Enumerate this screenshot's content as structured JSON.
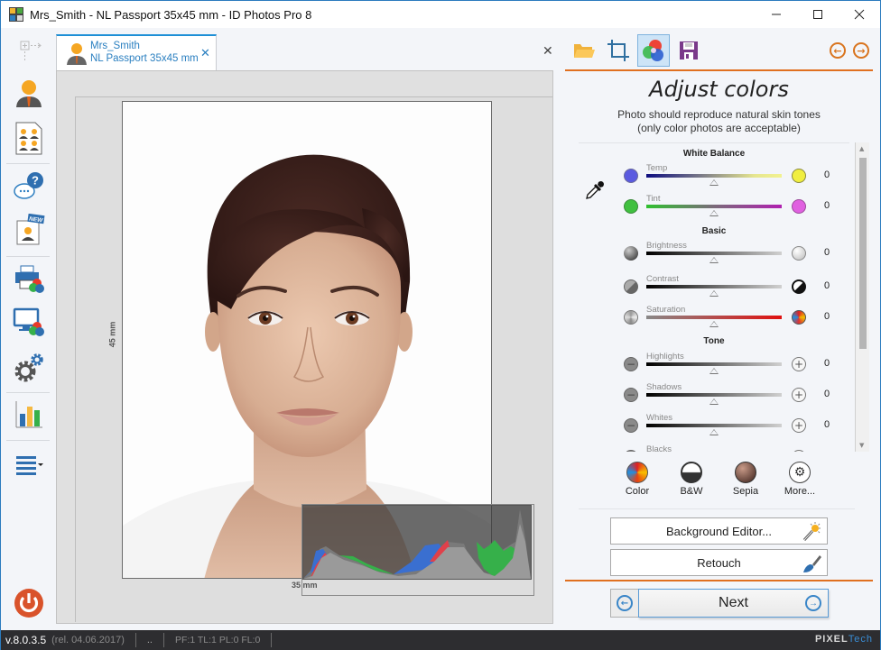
{
  "window": {
    "title": "Mrs_Smith - NL Passport 35x45 mm - ID Photos Pro 8",
    "controls": {
      "minimize": "—",
      "maximize": "☐",
      "close": "✕"
    }
  },
  "sidebar": {
    "items": [
      {
        "name": "new-project",
        "icon": "plus-arrow-icon"
      },
      {
        "name": "single-person",
        "icon": "person-icon"
      },
      {
        "name": "multi-photo-sheet",
        "icon": "multi-person-sheet-icon"
      },
      {
        "name": "help",
        "icon": "help-chat-icon"
      },
      {
        "name": "new-template",
        "icon": "new-badge-person-icon",
        "badge": "NEW"
      },
      {
        "name": "print-color",
        "icon": "printer-color-icon"
      },
      {
        "name": "monitor-color",
        "icon": "monitor-color-icon"
      },
      {
        "name": "settings",
        "icon": "gears-icon"
      },
      {
        "name": "statistics",
        "icon": "bar-chart-icon"
      },
      {
        "name": "menu",
        "icon": "hamburger-dropdown-icon"
      },
      {
        "name": "power",
        "icon": "power-icon"
      }
    ]
  },
  "doc_tab": {
    "name": "Mrs_Smith",
    "format": "NL Passport 35x45 mm",
    "close": "✕"
  },
  "canvas": {
    "close": "✕",
    "height_label": "45 mm",
    "width_label": "35 mm"
  },
  "right_panel": {
    "toolbar": [
      {
        "name": "open",
        "icon": "folder-icon"
      },
      {
        "name": "crop",
        "icon": "crop-icon"
      },
      {
        "name": "adjust-colors",
        "icon": "color-wheel-icon",
        "active": true
      },
      {
        "name": "save",
        "icon": "floppy-disk-icon"
      }
    ],
    "nav": {
      "back": "←",
      "forward": "→"
    },
    "title": "Adjust colors",
    "subtitle_line1": "Photo should reproduce natural skin tones",
    "subtitle_line2": "(only color photos are acceptable)",
    "sections": {
      "white_balance": "White Balance",
      "basic": "Basic",
      "tone": "Tone"
    },
    "adjustments": {
      "temp": {
        "label": "Temp",
        "value": "0",
        "position": 0.5
      },
      "tint": {
        "label": "Tint",
        "value": "0",
        "position": 0.5
      },
      "brightness": {
        "label": "Brightness",
        "value": "0",
        "position": 0.5
      },
      "contrast": {
        "label": "Contrast",
        "value": "0",
        "position": 0.5
      },
      "saturation": {
        "label": "Saturation",
        "value": "0",
        "position": 0.5
      },
      "highlights": {
        "label": "Highlights",
        "value": "0",
        "position": 0.5
      },
      "shadows": {
        "label": "Shadows",
        "value": "0",
        "position": 0.5
      },
      "whites": {
        "label": "Whites",
        "value": "0",
        "position": 0.5
      },
      "blacks": {
        "label": "Blacks"
      }
    },
    "presets": [
      {
        "label": "Color",
        "icon": "color-preset-icon"
      },
      {
        "label": "B&W",
        "icon": "bw-preset-icon"
      },
      {
        "label": "Sepia",
        "icon": "sepia-preset-icon"
      },
      {
        "label": "More...",
        "icon": "gear-icon"
      }
    ],
    "background_editor": "Background Editor...",
    "retouch": "Retouch",
    "next": "Next"
  },
  "colors": {
    "accent_orange": "#e07020",
    "accent_blue": "#2a7fc0",
    "statusbar_bg": "#2d2d30"
  },
  "statusbar": {
    "version": "v.8.0.3.5",
    "release": "(rel. 04.06.2017)",
    "dots": "..",
    "stats": "PF:1 TL:1 PL:0 FL:0",
    "brand_a": "PIXEL",
    "brand_b": "Tech"
  }
}
